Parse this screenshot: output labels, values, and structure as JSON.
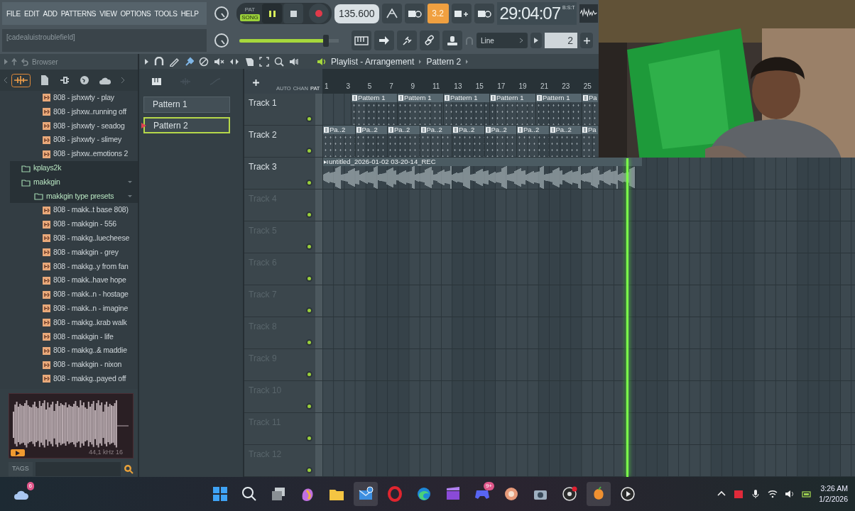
{
  "menu": [
    "FILE",
    "EDIT",
    "ADD",
    "PATTERNS",
    "VIEW",
    "OPTIONS",
    "TOOLS",
    "HELP"
  ],
  "transport": {
    "modes": [
      {
        "label": "PAT",
        "selected": false
      },
      {
        "label": "SONG",
        "selected": true
      }
    ],
    "playing": true,
    "tempo": "135.600",
    "step_button": "3.2",
    "time_label": "B:S:T",
    "time": "29:04:07"
  },
  "hint": "[cadealuistroublefield]",
  "master_volume": {
    "level": 0.9
  },
  "snap": "Line",
  "pattern_number": "2",
  "browser": {
    "title": "Browser",
    "tree": [
      {
        "kind": "file",
        "name": "808 - jshxwty - play"
      },
      {
        "kind": "file",
        "name": "808 - jshxw..running off"
      },
      {
        "kind": "file",
        "name": "808 - jshxwty - seadog"
      },
      {
        "kind": "file",
        "name": "808 - jshxwty - slimey"
      },
      {
        "kind": "file",
        "name": "808 - jshxw..emotions 2"
      },
      {
        "kind": "folder",
        "name": "kplays2k",
        "expanded": false
      },
      {
        "kind": "folder",
        "name": "makkgin",
        "expanded": true,
        "children": [
          {
            "kind": "folder",
            "name": "makkgin type presets",
            "expanded": true,
            "children": [
              {
                "kind": "file",
                "name": "808 - makk..t base 808)"
              },
              {
                "kind": "file",
                "name": "808 - makkgin - 556"
              },
              {
                "kind": "file",
                "name": "808 - makkg..luecheese"
              },
              {
                "kind": "file",
                "name": "808 - makkgin - grey"
              },
              {
                "kind": "file",
                "name": "808 - makkg..y from fan"
              },
              {
                "kind": "file",
                "name": "808 - makk..have hope"
              },
              {
                "kind": "file",
                "name": "808 - makk..n - hostage"
              },
              {
                "kind": "file",
                "name": "808 - makk..n - imagine"
              },
              {
                "kind": "file",
                "name": "808 - makkg..krab walk"
              },
              {
                "kind": "file",
                "name": "808 - makkgin - life"
              },
              {
                "kind": "file",
                "name": "808 - makkg..& maddie"
              },
              {
                "kind": "file",
                "name": "808 - makkgin - nixon"
              },
              {
                "kind": "file",
                "name": "808 - makkg..payed off"
              }
            ]
          }
        ]
      }
    ],
    "preview_info": "44,1 kHz 16",
    "tags": "TAGS"
  },
  "patterns": [
    {
      "name": "Pattern 1",
      "selected": false
    },
    {
      "name": "Pattern 2",
      "selected": true
    }
  ],
  "playlist": {
    "title": "Playlist - Arrangement",
    "pattern": "Pattern 2",
    "track_tabs": [
      "AUTO",
      "CHAN",
      "PAT"
    ],
    "ruler": [
      "1",
      "3",
      "5",
      "7",
      "9",
      "11",
      "13",
      "15",
      "17",
      "19",
      "21",
      "23",
      "25"
    ],
    "tracks": [
      {
        "name": "Track 1",
        "kind": "sparse",
        "active": true,
        "clips": [
          "Pattern 1",
          "Pattern 1",
          "Pattern 1",
          "Pattern 1",
          "Pattern 1",
          "Pa"
        ]
      },
      {
        "name": "Track 2",
        "kind": "dense",
        "active": true,
        "clips": [
          "Pa..2",
          "Pa..2",
          "Pa..2",
          "Pa..2",
          "Pa..2",
          "Pa..2",
          "Pa..2",
          "Pa..2",
          "Pa"
        ]
      },
      {
        "name": "Track 3",
        "kind": "audio",
        "active": true,
        "clips": [
          "untitled_2026-01-02 03-20-14_REC"
        ]
      },
      {
        "name": "Track 4",
        "kind": "empty",
        "active": true
      },
      {
        "name": "Track 5",
        "kind": "empty",
        "active": true
      },
      {
        "name": "Track 6",
        "kind": "empty",
        "active": true
      },
      {
        "name": "Track 7",
        "kind": "empty",
        "active": true
      },
      {
        "name": "Track 8",
        "kind": "empty",
        "active": true
      },
      {
        "name": "Track 9",
        "kind": "empty",
        "active": true
      },
      {
        "name": "Track 10",
        "kind": "empty",
        "active": true
      },
      {
        "name": "Track 11",
        "kind": "empty",
        "active": true
      },
      {
        "name": "Track 12",
        "kind": "empty",
        "active": true
      }
    ]
  },
  "webcam": {
    "kind": "picture"
  },
  "taskbar": {
    "weather_badge": "6",
    "chat_badge": "9+",
    "time": "3:26 AM",
    "date": "1/2/2026"
  }
}
